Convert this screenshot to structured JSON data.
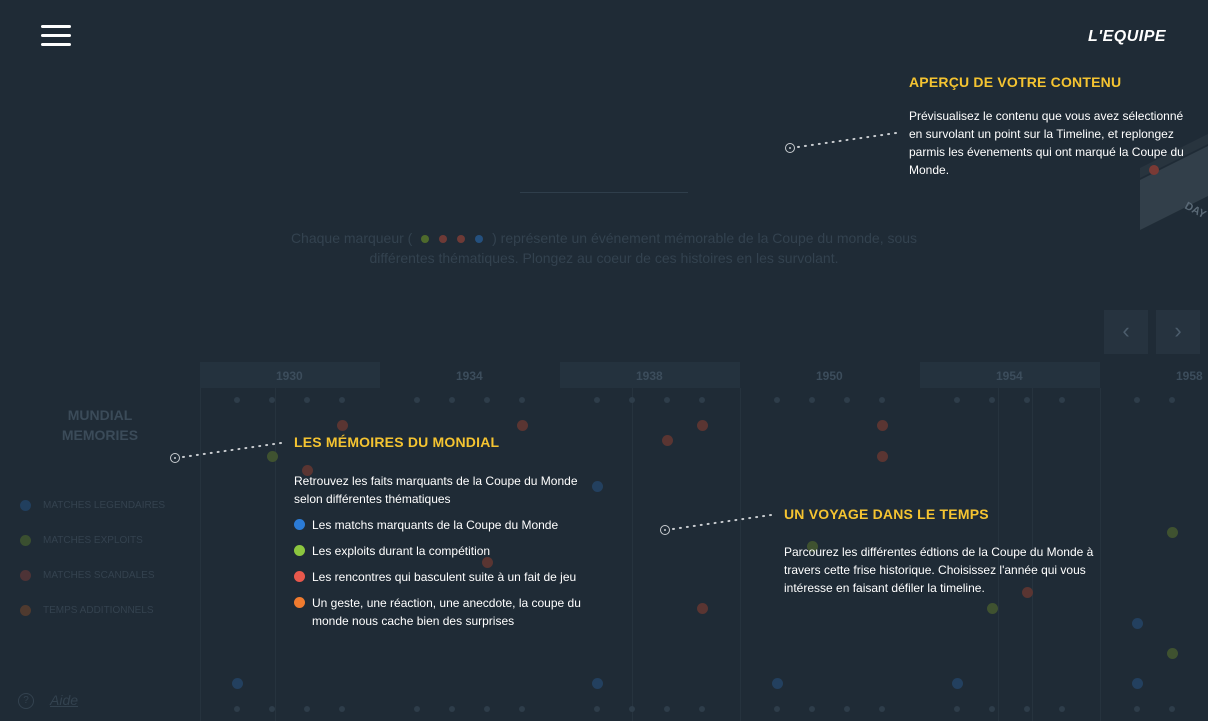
{
  "header": {
    "logo_text": "L'EQUIPE"
  },
  "background": {
    "intro_before": "Chaque marqueur (",
    "intro_after": ") représente un événement mémorable de la Coupe du monde, sous différentes thématiques. Plongez au coeur de ces histoires en les survolant.",
    "marker_colors": [
      "#8cc63f",
      "#e8584c",
      "#e8584c",
      "#2b7bd6"
    ],
    "section_title": "MUNDIAL MEMORIES",
    "legend": [
      {
        "label": "MATCHES LEGENDAIRES",
        "color": "#2b7bd6"
      },
      {
        "label": "MATCHES EXPLOITS",
        "color": "#8cc63f"
      },
      {
        "label": "MATCHES SCANDALES",
        "color": "#e8584c"
      },
      {
        "label": "TEMPS ADDITIONNELS",
        "color": "#f07b2f"
      }
    ],
    "years": [
      "1930",
      "1934",
      "1938",
      "1950",
      "1954",
      "1958"
    ],
    "help_label": "Aide",
    "help_icon": "question-circle-icon",
    "ribbon_text": "DAY"
  },
  "callouts": {
    "preview": {
      "title": "APERÇU DE VOTRE CONTENU",
      "text": "Prévisualisez le contenu que vous avez sélectionné en survolant un point sur la Timeline, et replongez parmis les évenements qui ont marqué la Coupe du Monde."
    },
    "memories": {
      "title": "LES MÉMOIRES DU MONDIAL",
      "text": "Retrouvez les faits marquants de la Coupe du Monde selon différentes thématiques",
      "items": [
        {
          "label": "Les matchs marquants de la Coupe du Monde",
          "color": "#2b7bd6"
        },
        {
          "label": "Les exploits durant la compétition",
          "color": "#8cc63f"
        },
        {
          "label": "Les rencontres qui basculent suite à un fait de jeu",
          "color": "#e8584c"
        },
        {
          "label": "Un geste, une réaction, une anecdote, la coupe du monde nous cache bien des surprises",
          "color": "#f07b2f"
        }
      ]
    },
    "voyage": {
      "title": "UN VOYAGE DANS LE TEMPS",
      "text": "Parcourez les différentes édtions de la Coupe du Monde à travers cette frise historique. Choisissez l'année qui vous intéresse en faisant défiler la timeline."
    }
  },
  "colors": {
    "background": "#1f2b36",
    "accent": "#f5c431",
    "blue": "#2b7bd6",
    "green": "#8cc63f",
    "red": "#e8584c",
    "orange": "#f07b2f"
  }
}
